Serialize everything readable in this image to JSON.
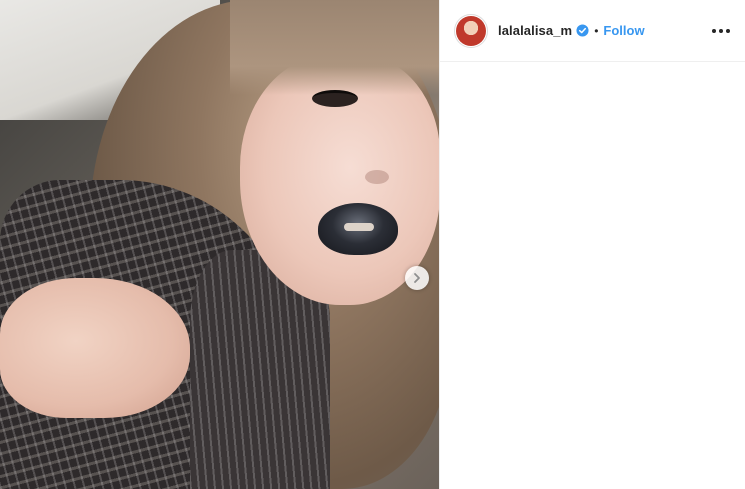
{
  "post": {
    "author": {
      "username": "lalalalisa_m",
      "verified": true
    },
    "separator": "•",
    "follow_label": "Follow",
    "more_icon": "ellipsis-icon",
    "carousel_next_icon": "chevron-right-icon"
  },
  "colors": {
    "follow_blue": "#3897f0",
    "verified_blue": "#3897f0",
    "text_dark": "#262626",
    "divider": "#efefef"
  }
}
